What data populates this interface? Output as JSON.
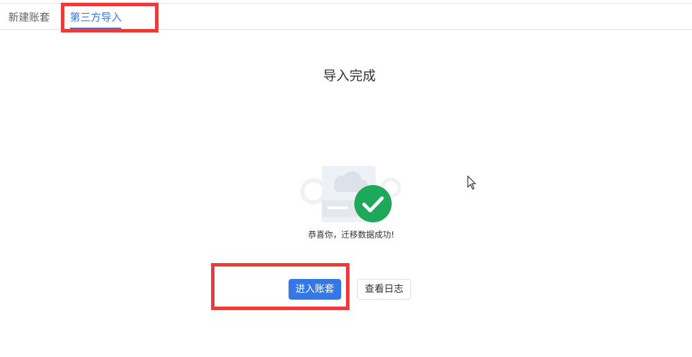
{
  "tabs": [
    {
      "label": "新建账套"
    },
    {
      "label": "第三方导入",
      "active": true
    }
  ],
  "result": {
    "title": "导入完成",
    "message": "恭喜你，迁移数据成功!",
    "icon": "success-check-icon",
    "status_color": "#1ea85a"
  },
  "actions": {
    "enter_label": "进入账套",
    "log_label": "查看日志"
  },
  "colors": {
    "accent": "#3478e6",
    "highlight_box": "#ea3a3a"
  }
}
